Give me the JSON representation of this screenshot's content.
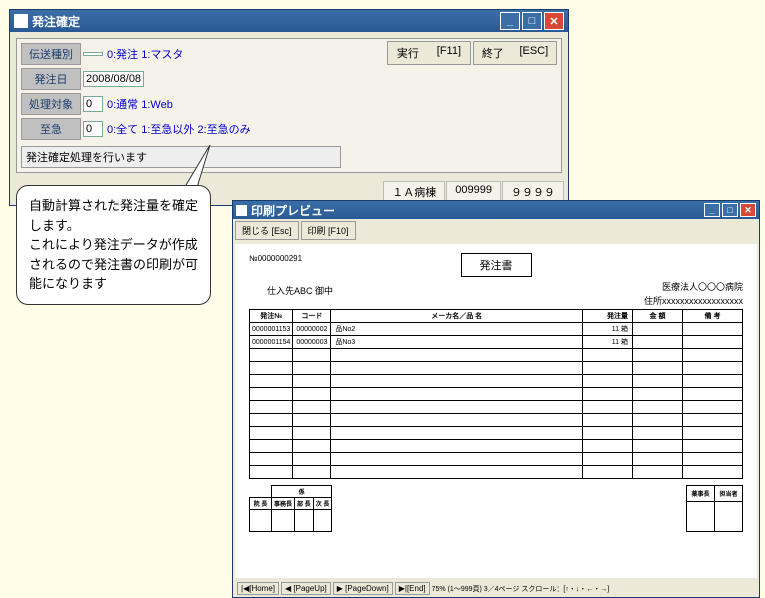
{
  "win1": {
    "title": "発注確定",
    "rows": {
      "r1": {
        "label": "伝送種別",
        "input": "",
        "text": "0:発注 1:マスタ"
      },
      "r2": {
        "label": "発注日",
        "input": "2008/08/08",
        "text": ""
      },
      "r3": {
        "label": "処理対象",
        "input": "0",
        "text": "0:通常 1:Web"
      },
      "r4": {
        "label": "至急",
        "input": "0",
        "text": "0:全て 1:至急以外 2:至急のみ"
      }
    },
    "btn1": {
      "label": "実行",
      "key": "[F11]"
    },
    "btn2": {
      "label": "終了",
      "key": "[ESC]"
    },
    "status": "発注確定処理を行います",
    "footer": {
      "a": "１Ａ病棟",
      "b": "009999",
      "c": "９９９９"
    }
  },
  "callout": {
    "text": "自動計算された発注量を確定します。\nこれにより発注データが作成されるので発注書の印刷が可能になります"
  },
  "win2": {
    "title": "印刷プレビュー",
    "tb": {
      "close": "閉じる [Esc]",
      "print": "印刷 [F10]"
    },
    "doc": {
      "no": "№0000000291",
      "title": "発注書",
      "org": "医療法人〇〇〇病院",
      "addr": "住所xxxxxxxxxxxxxxxxxx",
      "supplier": "仕入先ABC 御中",
      "headers": {
        "col1": "発注№",
        "col2": "コード",
        "col3": "メーカ名／品 名",
        "col4": "発注量",
        "col5": "金 額",
        "col6": "備 考"
      },
      "rows": [
        {
          "no": "0000001153",
          "code": "00000002",
          "name": "品No2",
          "qty": "11 箱"
        },
        {
          "no": "0000001154",
          "code": "00000003",
          "name": "品No3",
          "qty": "11 箱"
        }
      ],
      "sig_group": "係",
      "sig": {
        "a": "院 長",
        "b": "事務長",
        "c": "部 長",
        "d": "次 長"
      },
      "sig2": {
        "a": "薬事長",
        "b": "担当者"
      }
    },
    "footer": {
      "home": "|◀[Home]",
      "pgup": "◀ [PageUp]",
      "pgdn": "▶ [PageDown]",
      "end": "▶|[End]",
      "info": "75%  (1～999頁) 3／4ページ  スクロール：[↑・↓・←・→]"
    }
  }
}
